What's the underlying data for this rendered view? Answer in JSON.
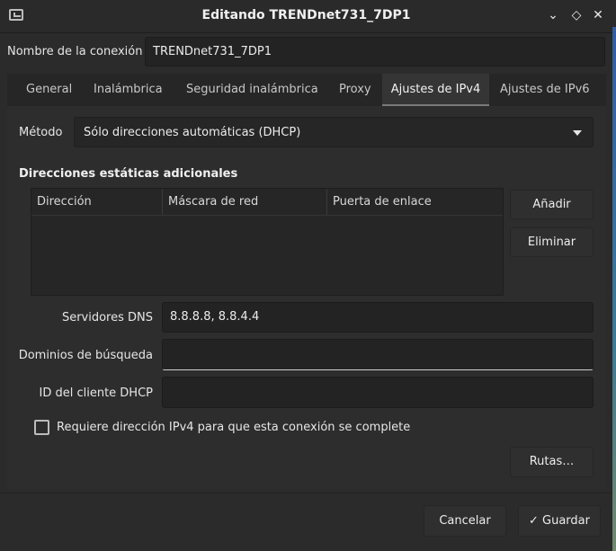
{
  "window": {
    "title": "Editando TRENDnet731_7DP1"
  },
  "connection": {
    "name_label": "Nombre de la conexión",
    "name_value": "TRENDnet731_7DP1"
  },
  "tabs": [
    {
      "label": "General"
    },
    {
      "label": "Inalámbrica"
    },
    {
      "label": "Seguridad inalámbrica"
    },
    {
      "label": "Proxy"
    },
    {
      "label": "Ajustes de IPv4"
    },
    {
      "label": "Ajustes de IPv6"
    }
  ],
  "ipv4": {
    "method_label": "Método",
    "method_value": "Sólo direcciones automáticas (DHCP)",
    "section_title": "Direcciones estáticas adicionales",
    "table_headers": [
      "Dirección",
      "Máscara de red",
      "Puerta de enlace"
    ],
    "add_button": "Añadir",
    "remove_button": "Eliminar",
    "dns_label": "Servidores DNS",
    "dns_value": "8.8.8.8, 8.8.4.4",
    "search_domains_label": "Dominios de búsqueda",
    "search_domains_value": "",
    "dhcp_client_id_label": "ID del cliente DHCP",
    "dhcp_client_id_value": "",
    "require_ipv4_label": "Requiere dirección IPv4 para que esta conexión se complete",
    "require_ipv4_checked": false,
    "routes_button": "Rutas…"
  },
  "footer": {
    "cancel_button": "Cancelar",
    "save_button": "Guardar"
  }
}
